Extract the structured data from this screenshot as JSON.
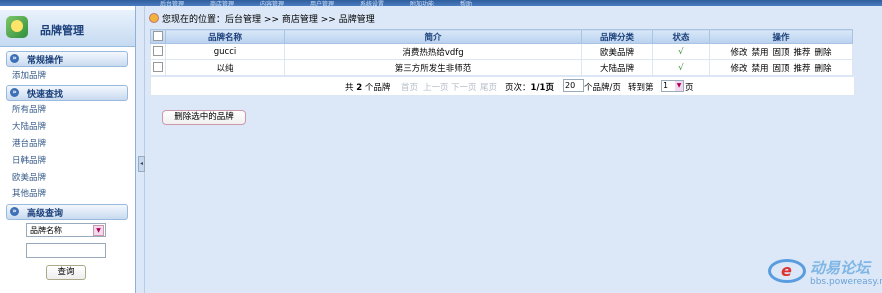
{
  "topbar": [
    "后台管理",
    "商店管理",
    "内容管理",
    "用户管理",
    "系统设置",
    "附加功能",
    "帮助"
  ],
  "sidebar": {
    "title": "品牌管理",
    "sections": [
      {
        "label": "常规操作",
        "items": [
          "添加品牌"
        ]
      },
      {
        "label": "快速查找",
        "items": [
          "所有品牌",
          "大陆品牌",
          "港台品牌",
          "日韩品牌",
          "欧美品牌",
          "其他品牌"
        ]
      },
      {
        "label": "高级查询",
        "items": []
      }
    ],
    "search": {
      "field_value": "品牌名称",
      "keyword_value": "",
      "button": "查询"
    }
  },
  "breadcrumb": {
    "prefix": "您现在的位置：",
    "path": [
      "后台管理",
      "商店管理",
      "品牌管理"
    ],
    "sep": ">>"
  },
  "table": {
    "headers": [
      "品牌名称",
      "简介",
      "品牌分类",
      "状态",
      "操作"
    ],
    "rows": [
      {
        "name": "gucci",
        "intro": "消费热热给vdfg",
        "category": "欧美品牌",
        "status": "√",
        "ops": [
          "修改",
          "禁用",
          "固顶",
          "推荐",
          "删除"
        ]
      },
      {
        "name": "以纯",
        "intro": "第三方所发生非师范",
        "category": "大陆品牌",
        "status": "√",
        "ops": [
          "修改",
          "禁用",
          "固顶",
          "推荐",
          "删除"
        ]
      }
    ]
  },
  "pager": {
    "total_prefix": "共",
    "total": "2",
    "total_suffix": "个品牌",
    "first": "首页",
    "prev": "上一页",
    "next": "下一页",
    "last": "尾页",
    "page_label": "页次：",
    "page_value": "1/1页",
    "per_page": "20",
    "per_page_suffix": "个品牌/页",
    "goto_label": "转到第",
    "goto_value": "1",
    "goto_suffix": "页"
  },
  "delete_selected": "删除选中的品牌",
  "watermark": {
    "title": "动易论坛",
    "url": "bbs.powereasy.net"
  }
}
